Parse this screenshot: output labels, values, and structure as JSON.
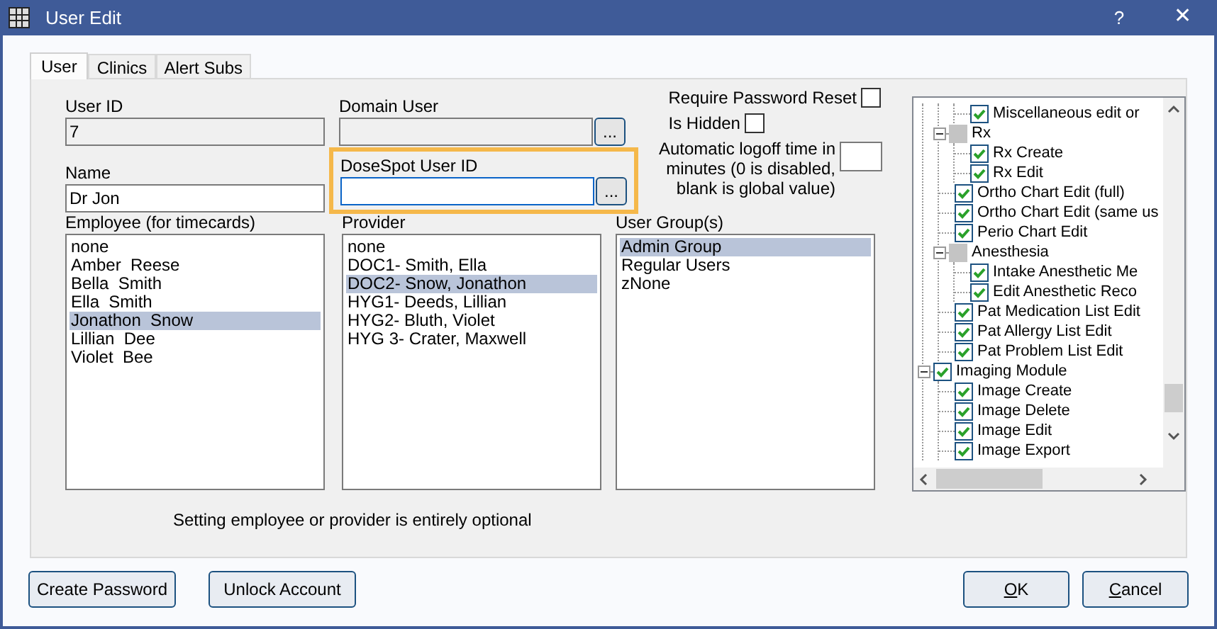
{
  "window": {
    "title": "User Edit",
    "help": "?",
    "close": "✕"
  },
  "tabs": [
    {
      "label": "User",
      "selected": true
    },
    {
      "label": "Clinics",
      "selected": false
    },
    {
      "label": "Alert Subs",
      "selected": false
    }
  ],
  "user_id": {
    "label": "User ID",
    "value": "7",
    "disabled": true
  },
  "domain_user": {
    "label": "Domain User",
    "value_disabled": true,
    "browse": "..."
  },
  "name": {
    "label": "Name",
    "value": "Dr Jon"
  },
  "dosespot_user_id": {
    "label": "DoseSpot User ID",
    "highlighted": true,
    "focused": true,
    "browse": "..."
  },
  "require_password_reset": {
    "label": "Require Password Reset",
    "checked": false
  },
  "is_hidden": {
    "label": "Is Hidden",
    "checked": false
  },
  "logoff": {
    "label": "Automatic logoff time in minutes (0 is disabled, blank is global value)"
  },
  "employee": {
    "label": "Employee (for timecards)",
    "items": [
      {
        "text": "none",
        "selected": false
      },
      {
        "text": "Amber  Reese",
        "selected": false
      },
      {
        "text": "Bella  Smith",
        "selected": false
      },
      {
        "text": "Ella  Smith",
        "selected": false
      },
      {
        "text": "Jonathon  Snow",
        "selected": true
      },
      {
        "text": "Lillian  Dee",
        "selected": false
      },
      {
        "text": "Violet  Bee",
        "selected": false
      }
    ]
  },
  "provider": {
    "label": "Provider",
    "items": [
      {
        "text": "none",
        "selected": false
      },
      {
        "text": "DOC1- Smith, Ella",
        "selected": false
      },
      {
        "text": "DOC2- Snow, Jonathon",
        "selected": true
      },
      {
        "text": "HYG1- Deeds, Lillian",
        "selected": false
      },
      {
        "text": "HYG2- Bluth, Violet",
        "selected": false
      },
      {
        "text": "HYG 3- Crater, Maxwell",
        "selected": false
      }
    ]
  },
  "user_groups": {
    "label": "User Group(s)",
    "items": [
      {
        "text": "Admin Group",
        "selected": true
      },
      {
        "text": "Regular Users",
        "selected": false
      },
      {
        "text": "zNone",
        "selected": false
      }
    ]
  },
  "note": "Setting employee or provider is entirely optional",
  "permissions_tree": {
    "nodes": [
      {
        "continued": true,
        "children": [
          {
            "continued": true,
            "children": [
              {
                "label": "Miscellaneous edit or",
                "checked": true,
                "indeterminate": false
              }
            ]
          },
          {
            "label": "Rx",
            "checked": false,
            "indeterminate": true,
            "expanded": true,
            "children": [
              {
                "label": "Rx Create",
                "checked": true,
                "indeterminate": false
              },
              {
                "label": "Rx Edit",
                "checked": true,
                "indeterminate": false
              }
            ]
          },
          {
            "label": "Ortho Chart Edit (full)",
            "checked": true,
            "indeterminate": false
          },
          {
            "label": "Ortho Chart Edit (same us",
            "checked": true,
            "indeterminate": false
          },
          {
            "label": "Perio Chart Edit",
            "checked": true,
            "indeterminate": false
          },
          {
            "label": "Anesthesia",
            "checked": false,
            "indeterminate": true,
            "expanded": true,
            "children": [
              {
                "label": "Intake Anesthetic Me",
                "checked": true,
                "indeterminate": false
              },
              {
                "label": "Edit Anesthetic Reco",
                "checked": true,
                "indeterminate": false
              }
            ]
          },
          {
            "label": "Pat Medication List Edit",
            "checked": true,
            "indeterminate": false
          },
          {
            "label": "Pat Allergy List Edit",
            "checked": true,
            "indeterminate": false
          },
          {
            "label": "Pat Problem List Edit",
            "checked": true,
            "indeterminate": false
          }
        ]
      },
      {
        "label": "Imaging Module",
        "checked": true,
        "indeterminate": false,
        "expanded": true,
        "children": [
          {
            "label": "Image Create",
            "checked": true,
            "indeterminate": false
          },
          {
            "label": "Image Delete",
            "checked": true,
            "indeterminate": false
          },
          {
            "label": "Image Edit",
            "checked": true,
            "indeterminate": false
          },
          {
            "label": "Image Export",
            "checked": true,
            "indeterminate": false
          }
        ]
      }
    ]
  },
  "buttons_left": [
    {
      "label": "Create Password"
    },
    {
      "label": "Unlock Account"
    }
  ],
  "buttons_right": [
    {
      "label": "OK"
    },
    {
      "label": "Cancel"
    }
  ]
}
